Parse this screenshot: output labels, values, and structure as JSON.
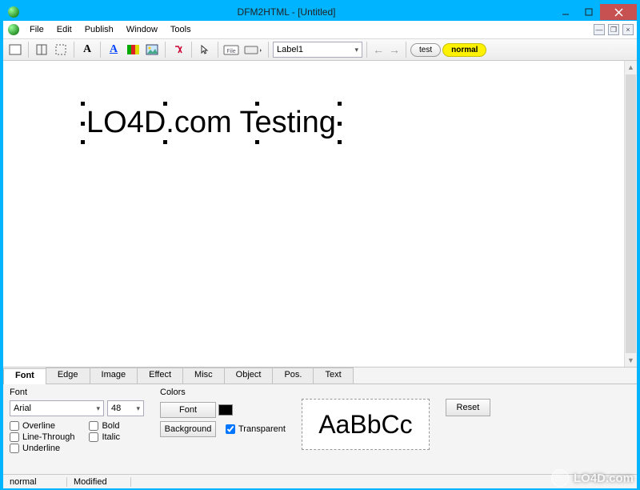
{
  "title": "DFM2HTML - [Untitled]",
  "menu": {
    "file": "File",
    "edit": "Edit",
    "publish": "Publish",
    "window": "Window",
    "tools": "Tools"
  },
  "toolbar": {
    "label_combo": "Label1",
    "state_test": "test",
    "state_normal": "normal"
  },
  "canvas": {
    "label_text": "LO4D.com Testing"
  },
  "tabs": {
    "font": "Font",
    "edge": "Edge",
    "image": "Image",
    "effect": "Effect",
    "misc": "Misc",
    "object": "Object",
    "pos": "Pos.",
    "text": "Text"
  },
  "fontpanel": {
    "font_label": "Font",
    "font_value": "Arial",
    "size_value": "48",
    "chk_overline": "Overline",
    "chk_linethrough": "Line-Through",
    "chk_underline": "Underline",
    "chk_bold": "Bold",
    "chk_italic": "Italic",
    "colors_label": "Colors",
    "font_btn": "Font",
    "bg_btn": "Background",
    "transparent": "Transparent",
    "transparent_checked": true,
    "preview": "AaBbCc",
    "reset": "Reset"
  },
  "status": {
    "normal": "normal",
    "modified": "Modified"
  },
  "watermark": "LO4D.com"
}
